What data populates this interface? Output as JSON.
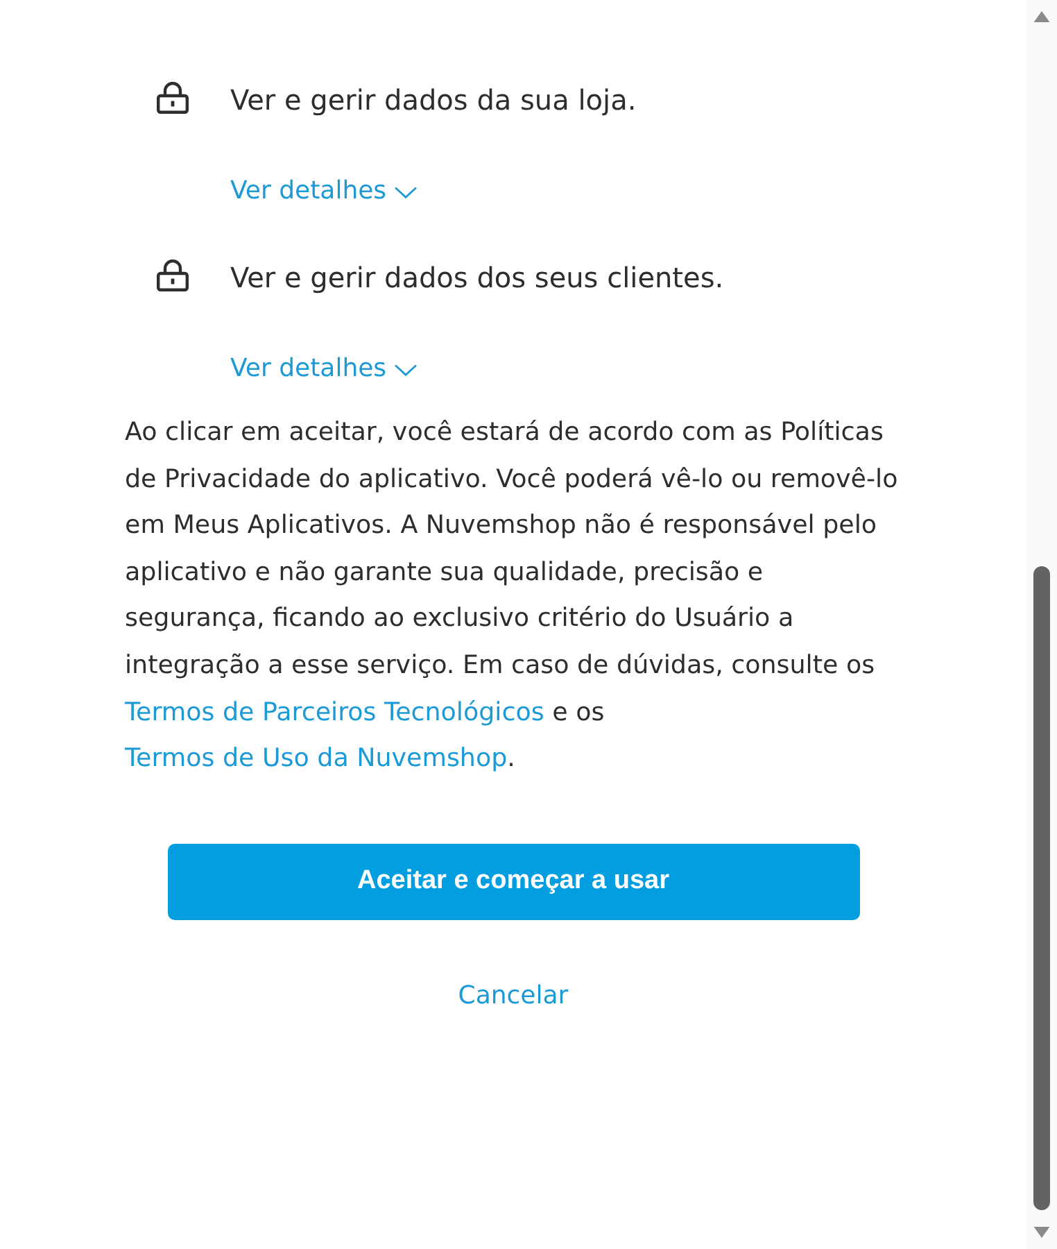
{
  "permissions": [
    {
      "text": "Ver e gerir dados da sua loja.",
      "details_link": "Ver detalhes",
      "expanded": false
    },
    {
      "text": "Ver e gerir dados dos seus clientes.",
      "details_link": "Ver detalhes",
      "expanded": false
    }
  ],
  "consent": {
    "parts": [
      {
        "kind": "text",
        "text": "Ao clicar em aceitar, você estará de acordo com as Políticas de Privacidade do aplicativo. Você poderá vê-lo ou removê-lo em Meus Aplicativos. A Nuvemshop não é responsável pelo aplicativo e não garante sua qualidade, precisão e segurança, ficando ao exclusivo critério do Usuário a integração a esse serviço. Em caso de dúvidas, consulte os "
      },
      {
        "kind": "link",
        "text": "Termos de Parceiros Tecnológicos"
      },
      {
        "kind": "text",
        "text": " e os "
      },
      {
        "kind": "link",
        "text": "Termos de Uso da Nuvemshop"
      },
      {
        "kind": "text",
        "text": "."
      }
    ]
  },
  "actions": [
    {
      "kind": "primary",
      "label": "Aceitar e começar a usar"
    },
    {
      "kind": "link",
      "label": "Cancelar"
    }
  ]
}
